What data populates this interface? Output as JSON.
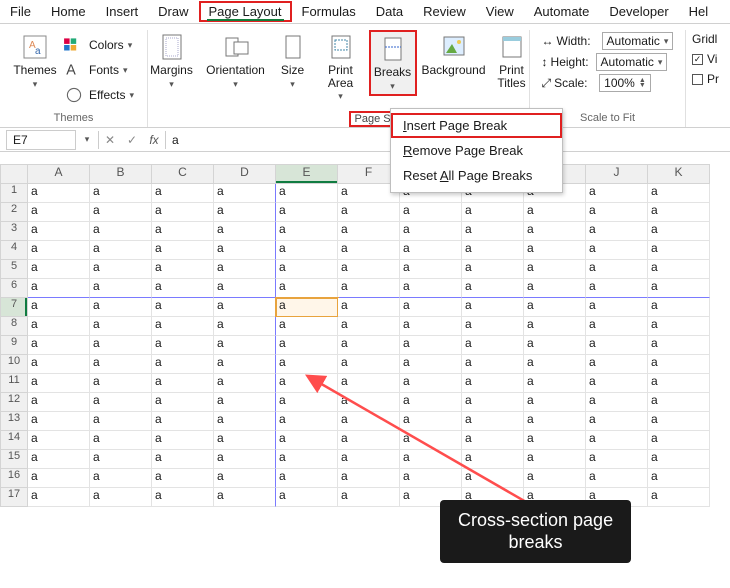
{
  "tabs": [
    "File",
    "Home",
    "Insert",
    "Draw",
    "Page Layout",
    "Formulas",
    "Data",
    "Review",
    "View",
    "Automate",
    "Developer",
    "Hel"
  ],
  "active_tab_index": 4,
  "ribbon": {
    "themes": {
      "big": "Themes",
      "colors": "Colors",
      "fonts": "Fonts",
      "effects": "Effects",
      "label": "Themes"
    },
    "page_setup": {
      "margins": "Margins",
      "orientation": "Orientation",
      "size": "Size",
      "print_area": "Print\nArea",
      "breaks": "Breaks",
      "background": "Background",
      "print_titles": "Print\nTitles",
      "label": "Page Setup"
    },
    "scale": {
      "width_lbl": "Width:",
      "height_lbl": "Height:",
      "scale_lbl": "Scale:",
      "width_val": "Automatic",
      "height_val": "Automatic",
      "scale_val": "100%",
      "label": "Scale to Fit"
    },
    "right": {
      "gridl": "Gridl",
      "vi": "Vi",
      "pr": "Pr"
    }
  },
  "breaks_menu": {
    "insert": "Insert Page Break",
    "remove": "Remove Page Break",
    "reset": "Reset All Page Breaks",
    "insert_u": "I",
    "remove_u": "R",
    "reset_u": "A"
  },
  "fbar": {
    "name": "E7",
    "fx": "fx",
    "value": "a"
  },
  "cols": [
    "A",
    "B",
    "C",
    "D",
    "E",
    "F",
    "G",
    "H",
    "I",
    "J",
    "K"
  ],
  "rows": 17,
  "cell_fill": "a",
  "selected": {
    "col": "E",
    "row": 7
  },
  "annotation": "Cross-section page\nbreaks"
}
